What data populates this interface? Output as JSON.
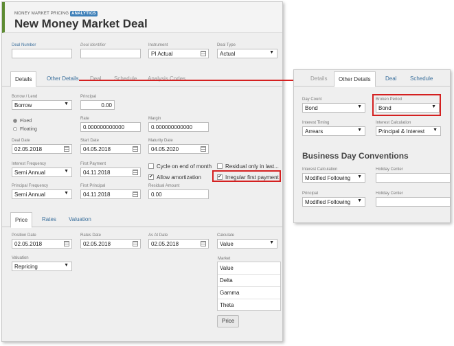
{
  "header": {
    "subtitle": "MONEY MARKET PRICING",
    "badge": "ANALYTICS",
    "title": "New Money Market Deal"
  },
  "top_fields": {
    "deal_number": {
      "label": "Deal Number",
      "value": ""
    },
    "deal_identifier": {
      "label": "Deal Identifier",
      "value": ""
    },
    "instrument": {
      "label": "Instrument",
      "value": "PI Actual"
    },
    "deal_type": {
      "label": "Deal Type",
      "value": "Actual"
    }
  },
  "main_tabs": [
    "Details",
    "Other Details",
    "Deal",
    "Schedule",
    "Analysis Codes"
  ],
  "details": {
    "borrow_lend": {
      "label": "Borrow / Lend",
      "value": "Borrow"
    },
    "principal": {
      "label": "Principal",
      "value": "0.00"
    },
    "rate_type": {
      "fixed": "Fixed",
      "floating": "Floating"
    },
    "rate": {
      "label": "Rate",
      "value": "0.000000000000"
    },
    "margin": {
      "label": "Margin",
      "value": "0.000000000000"
    },
    "deal_date": {
      "label": "Deal Date",
      "value": "02.05.2018"
    },
    "start_date": {
      "label": "Start Date",
      "value": "04.05.2018"
    },
    "maturity_date": {
      "label": "Maturity Date",
      "value": "04.05.2020"
    },
    "interest_frequency": {
      "label": "Interest Frequency",
      "value": "Semi Annual"
    },
    "first_payment": {
      "label": "First Payment",
      "value": "04.11.2018"
    },
    "cycle_on_end": "Cycle on end of month",
    "residual_only": "Residual only in last...",
    "allow_amortization": "Allow amortization",
    "irregular_first_payment": "Irregular first payment",
    "principal_frequency": {
      "label": "Principal Frequency",
      "value": "Semi Annual"
    },
    "first_principal": {
      "label": "First Principal",
      "value": "04.11.2018"
    },
    "residual_amount": {
      "label": "Residual Amount",
      "value": "0.00"
    }
  },
  "price_tabs": [
    "Price",
    "Rates",
    "Valuation"
  ],
  "price": {
    "position_date": {
      "label": "Position Date",
      "value": "02.05.2018"
    },
    "rates_date": {
      "label": "Rates Date",
      "value": "02.05.2018"
    },
    "as_at_date": {
      "label": "As At Date",
      "value": "02.05.2018"
    },
    "calculate": {
      "label": "Calculate",
      "value": "Value"
    },
    "valuation": {
      "label": "Valuation",
      "value": "Repricing"
    },
    "market": {
      "label": "Market",
      "items": [
        "Value",
        "Delta",
        "Gamma",
        "Theta"
      ]
    },
    "price_button": "Price"
  },
  "side_tabs": [
    "Details",
    "Other Details",
    "Deal",
    "Schedule"
  ],
  "other_details": {
    "day_count": {
      "label": "Day Count",
      "value": "Bond"
    },
    "broken_period": {
      "label": "Broken Period",
      "value": "Bond"
    },
    "interest_timing": {
      "label": "Interest Timing",
      "value": "Arrears"
    },
    "interest_calculation": {
      "label": "Interest Calculation",
      "value": "Principal & Interest"
    },
    "section_title": "Business Day Conventions",
    "bdc_interest_calculation": {
      "label": "Interest Calculation",
      "value": "Modified Following"
    },
    "holiday_center_1": {
      "label": "Holiday Center",
      "value": ""
    },
    "bdc_principal": {
      "label": "Principal",
      "value": "Modified Following"
    },
    "holiday_center_2": {
      "label": "Holiday Center",
      "value": ""
    }
  },
  "colors": {
    "accent": "#5d8b32",
    "highlight": "#d42020",
    "link": "#3a6f9c",
    "badge": "#3d7fb8"
  }
}
